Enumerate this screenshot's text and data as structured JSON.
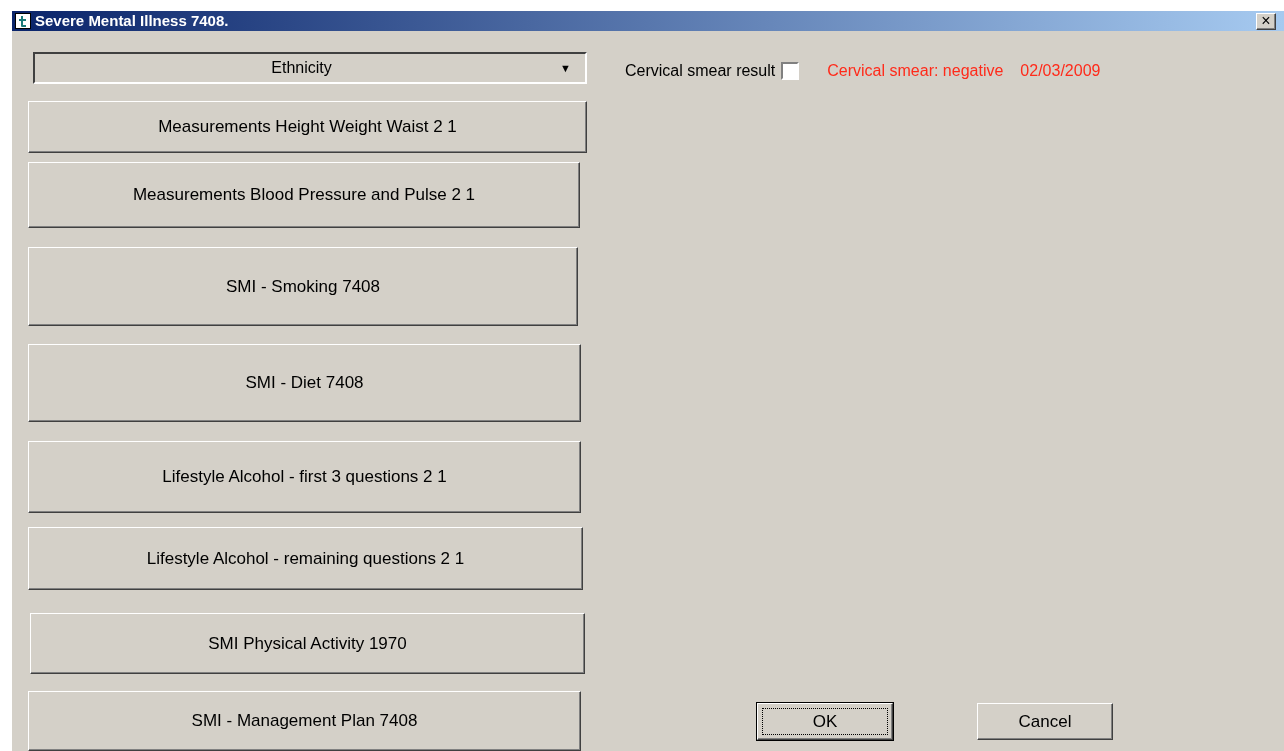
{
  "window": {
    "title": "Severe Mental Illness 7408.",
    "close_label": "×"
  },
  "dropdown": {
    "value": "Ethnicity",
    "arrow": "▼"
  },
  "buttons": [
    {
      "label": "Measurements Height Weight Waist 2 1"
    },
    {
      "label": "Measurements Blood Pressure and Pulse 2 1"
    },
    {
      "label": "SMI - Smoking 7408"
    },
    {
      "label": "SMI - Diet 7408"
    },
    {
      "label": "Lifestyle Alcohol - first 3 questions 2 1"
    },
    {
      "label": "Lifestyle Alcohol - remaining questions 2 1"
    },
    {
      "label": "SMI Physical Activity 1970"
    },
    {
      "label": "SMI - Management Plan 7408"
    }
  ],
  "cervical": {
    "label": "Cervical smear result",
    "checked": false,
    "result": "Cervical smear: negative",
    "date": "02/03/2009"
  },
  "dialog_buttons": [
    {
      "label": "OK",
      "default": true
    },
    {
      "label": "Cancel",
      "default": false
    }
  ]
}
